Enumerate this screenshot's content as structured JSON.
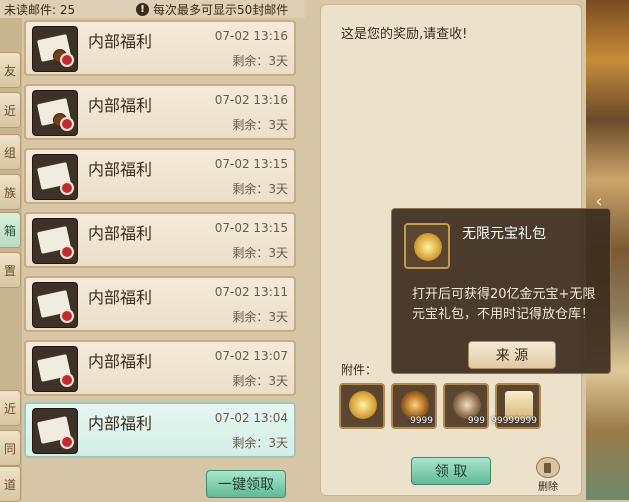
{
  "header": {
    "unread_label": "未读邮件: 25",
    "notice": "每次最多可显示50封邮件"
  },
  "side_tabs": [
    "友",
    "近",
    "组",
    "族",
    "箱",
    "置",
    "近",
    "同",
    "道"
  ],
  "mails": [
    {
      "title": "内部福利",
      "date": "07-02 13:16",
      "remain": "剩余：3天",
      "opened": false
    },
    {
      "title": "内部福利",
      "date": "07-02 13:16",
      "remain": "剩余：3天",
      "opened": false
    },
    {
      "title": "内部福利",
      "date": "07-02 13:15",
      "remain": "剩余：3天",
      "opened": true
    },
    {
      "title": "内部福利",
      "date": "07-02 13:15",
      "remain": "剩余：3天",
      "opened": true
    },
    {
      "title": "内部福利",
      "date": "07-02 13:11",
      "remain": "剩余：3天",
      "opened": true
    },
    {
      "title": "内部福利",
      "date": "07-02 13:07",
      "remain": "剩余：3天",
      "opened": true
    },
    {
      "title": "内部福利",
      "date": "07-02 13:04",
      "remain": "剩余：3天",
      "opened": true,
      "selected": true
    }
  ],
  "claim_all_button": "一键领取",
  "content": {
    "message": "这是您的奖励,请查收!",
    "attachments_label": "附件：",
    "attachments": [
      {
        "name": "yuanbao-giftpack-icon",
        "qty": ""
      },
      {
        "name": "gold-helmet-icon",
        "qty": "9999"
      },
      {
        "name": "armor-icon",
        "qty": "999"
      },
      {
        "name": "scroll-icon",
        "qty": "99999999"
      }
    ],
    "claim_button": "领 取",
    "delete_label": "删除"
  },
  "tooltip": {
    "title": "无限元宝礼包",
    "description": "打开后可获得20亿金元宝+无限元宝礼包，不用时记得放仓库！",
    "source_button": "来 源"
  }
}
